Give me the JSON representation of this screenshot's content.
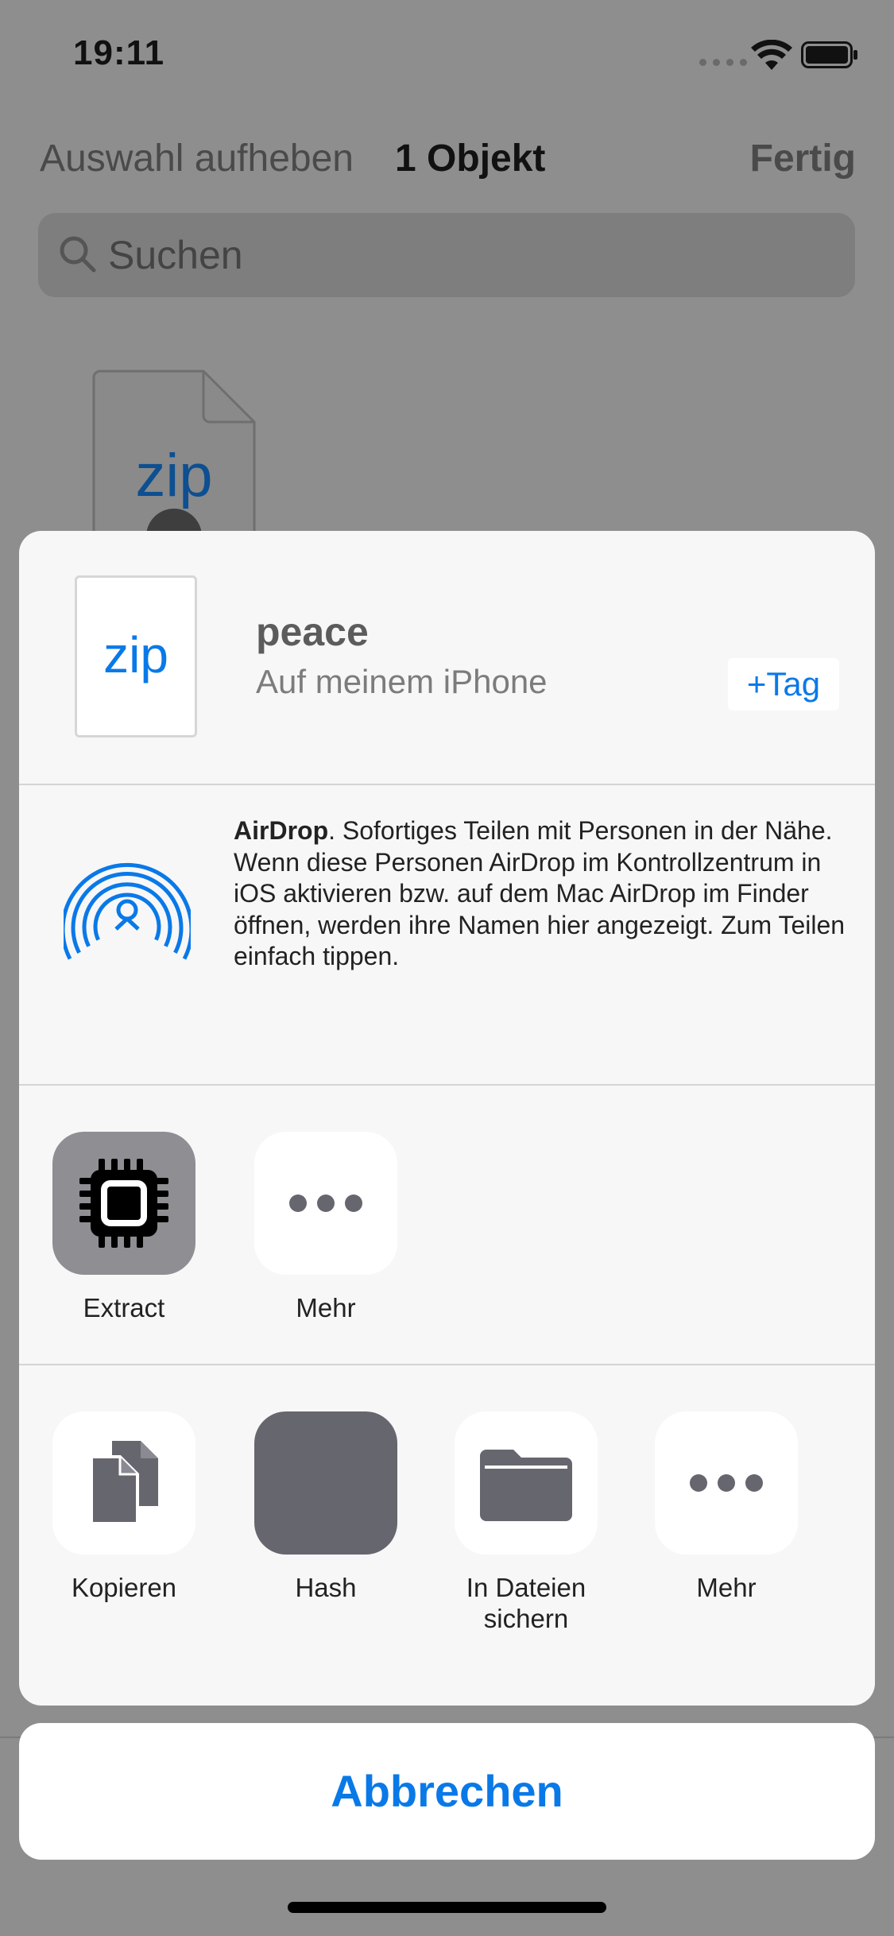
{
  "status_bar": {
    "time": "19:11"
  },
  "navbar": {
    "left_label": "Auswahl aufheben",
    "title": "1 Objekt",
    "right_label": "Fertig"
  },
  "search": {
    "placeholder": "Suchen"
  },
  "background_file": {
    "icon_text": "zip"
  },
  "sheet": {
    "file": {
      "icon_text": "zip",
      "name": "peace",
      "location": "Auf meinem iPhone",
      "tag_button": "+Tag"
    },
    "airdrop": {
      "title": "AirDrop",
      "description": ". Sofortiges Teilen mit Personen in der Nähe. Wenn diese Personen AirDrop im Kontrollzentrum in iOS aktivieren bzw. auf dem Mac AirDrop im Finder öffnen, werden ihre Namen hier angezeigt. Zum Teilen einfach tippen."
    },
    "apps": [
      {
        "label": "Extract",
        "icon": "chip-icon"
      },
      {
        "label": "Mehr",
        "icon": "more-icon"
      }
    ],
    "actions": [
      {
        "label": "Kopieren",
        "icon": "copy-icon"
      },
      {
        "label": "Hash",
        "icon": "blank-icon"
      },
      {
        "label": "In Dateien sichern",
        "icon": "folder-icon"
      },
      {
        "label": "Mehr",
        "icon": "more-icon"
      }
    ]
  },
  "cancel": {
    "label": "Abbrechen"
  },
  "colors": {
    "accent": "#0a79e8",
    "sheet_bg": "#f7f7f7",
    "icon_gray": "#66666e"
  }
}
